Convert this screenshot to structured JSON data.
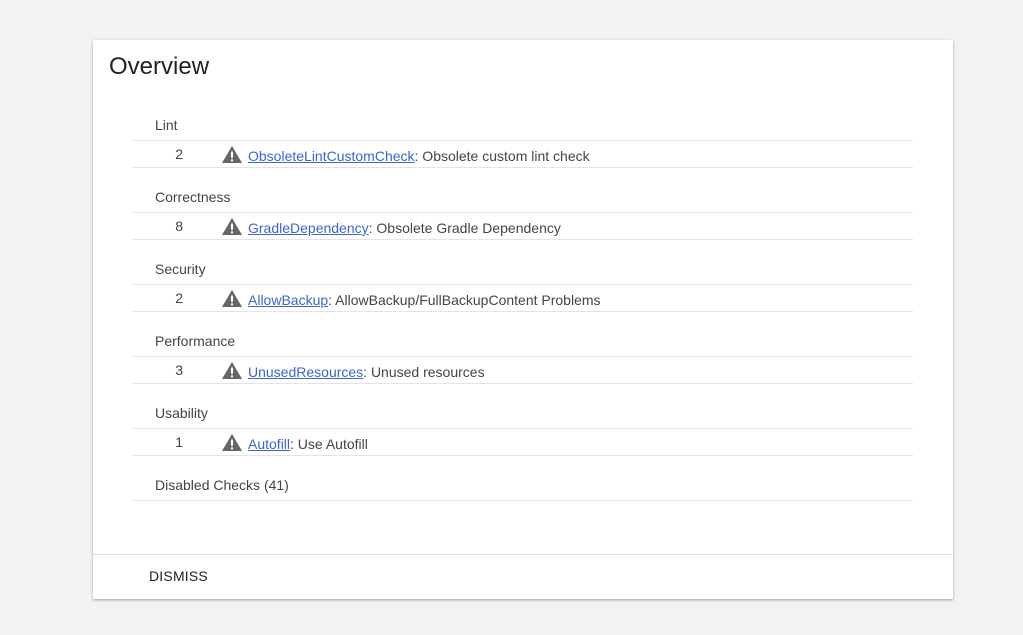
{
  "card": {
    "title": "Overview"
  },
  "categories": [
    {
      "label": "Lint",
      "issue": {
        "count": "2",
        "link": "ObsoleteLintCustomCheck",
        "description": ": Obsolete custom lint check"
      }
    },
    {
      "label": "Correctness",
      "issue": {
        "count": "8",
        "link": "GradleDependency",
        "description": ": Obsolete Gradle Dependency"
      }
    },
    {
      "label": "Security",
      "issue": {
        "count": "2",
        "link": "AllowBackup",
        "description": ": AllowBackup/FullBackupContent Problems"
      }
    },
    {
      "label": "Performance",
      "issue": {
        "count": "3",
        "link": "UnusedResources",
        "description": ": Unused resources"
      }
    },
    {
      "label": "Usability",
      "issue": {
        "count": "1",
        "link": "Autofill",
        "description": ": Use Autofill"
      }
    }
  ],
  "disabled_checks": "Disabled Checks (41)",
  "footer": {
    "dismiss_label": "DISMISS"
  },
  "colors": {
    "link": "#3b63d6",
    "warning_icon": "#666666"
  },
  "icons": {
    "issue": "warning-triangle-icon"
  }
}
